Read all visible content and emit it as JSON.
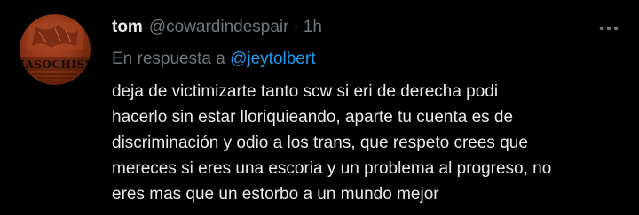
{
  "tweet": {
    "display_name": "tom",
    "handle": "@cowardindespair",
    "separator": "·",
    "time": "1h",
    "avatar_text": "MASOCHISM",
    "reply_prefix": "En respuesta a",
    "reply_user": "@jeytolbert",
    "body_lines": [
      "deja de victimizarte tanto scw si eri de derecha podi",
      "hacerlo sin estar lloriquieando, aparte tu cuenta es de",
      "discriminación y odio a los trans, que respeto crees que",
      "mereces si eres una escoria y un problema al progreso, no",
      "eres mas que un estorbo a un mundo mejor"
    ]
  },
  "icons": {
    "more": "more-options-icon"
  },
  "colors": {
    "background": "#000000",
    "primary_text": "#e7e9ea",
    "secondary_text": "#71767b",
    "link": "#1d9bf0"
  }
}
